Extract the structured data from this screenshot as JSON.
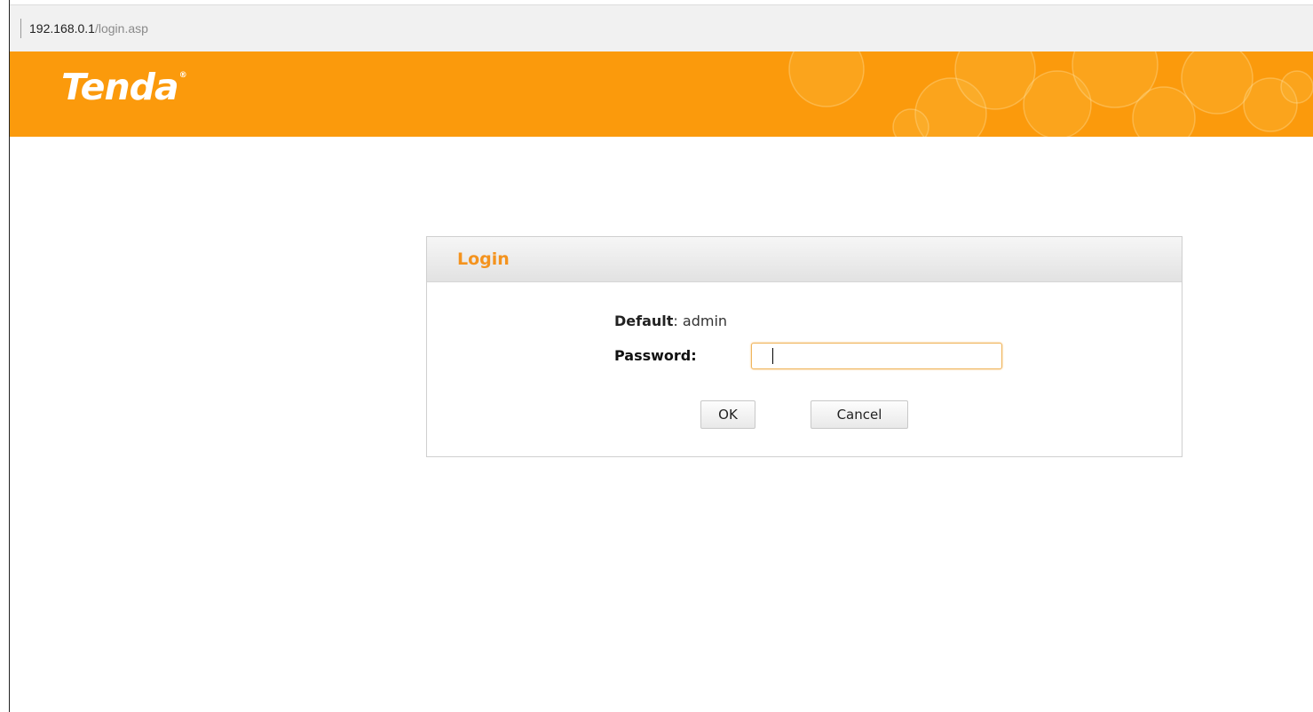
{
  "address_bar": {
    "host": "192.168.0.1",
    "path": "/login.asp"
  },
  "header": {
    "logo_text": "Tenda",
    "logo_mark": "®",
    "background_color": "#fb9a0c"
  },
  "login": {
    "title": "Login",
    "default_label": "Default",
    "default_sep": ":",
    "default_value": "admin",
    "password_label": "Password:",
    "password_value": "",
    "ok_label": "OK",
    "cancel_label": "Cancel",
    "accent_color": "#f4931e"
  }
}
